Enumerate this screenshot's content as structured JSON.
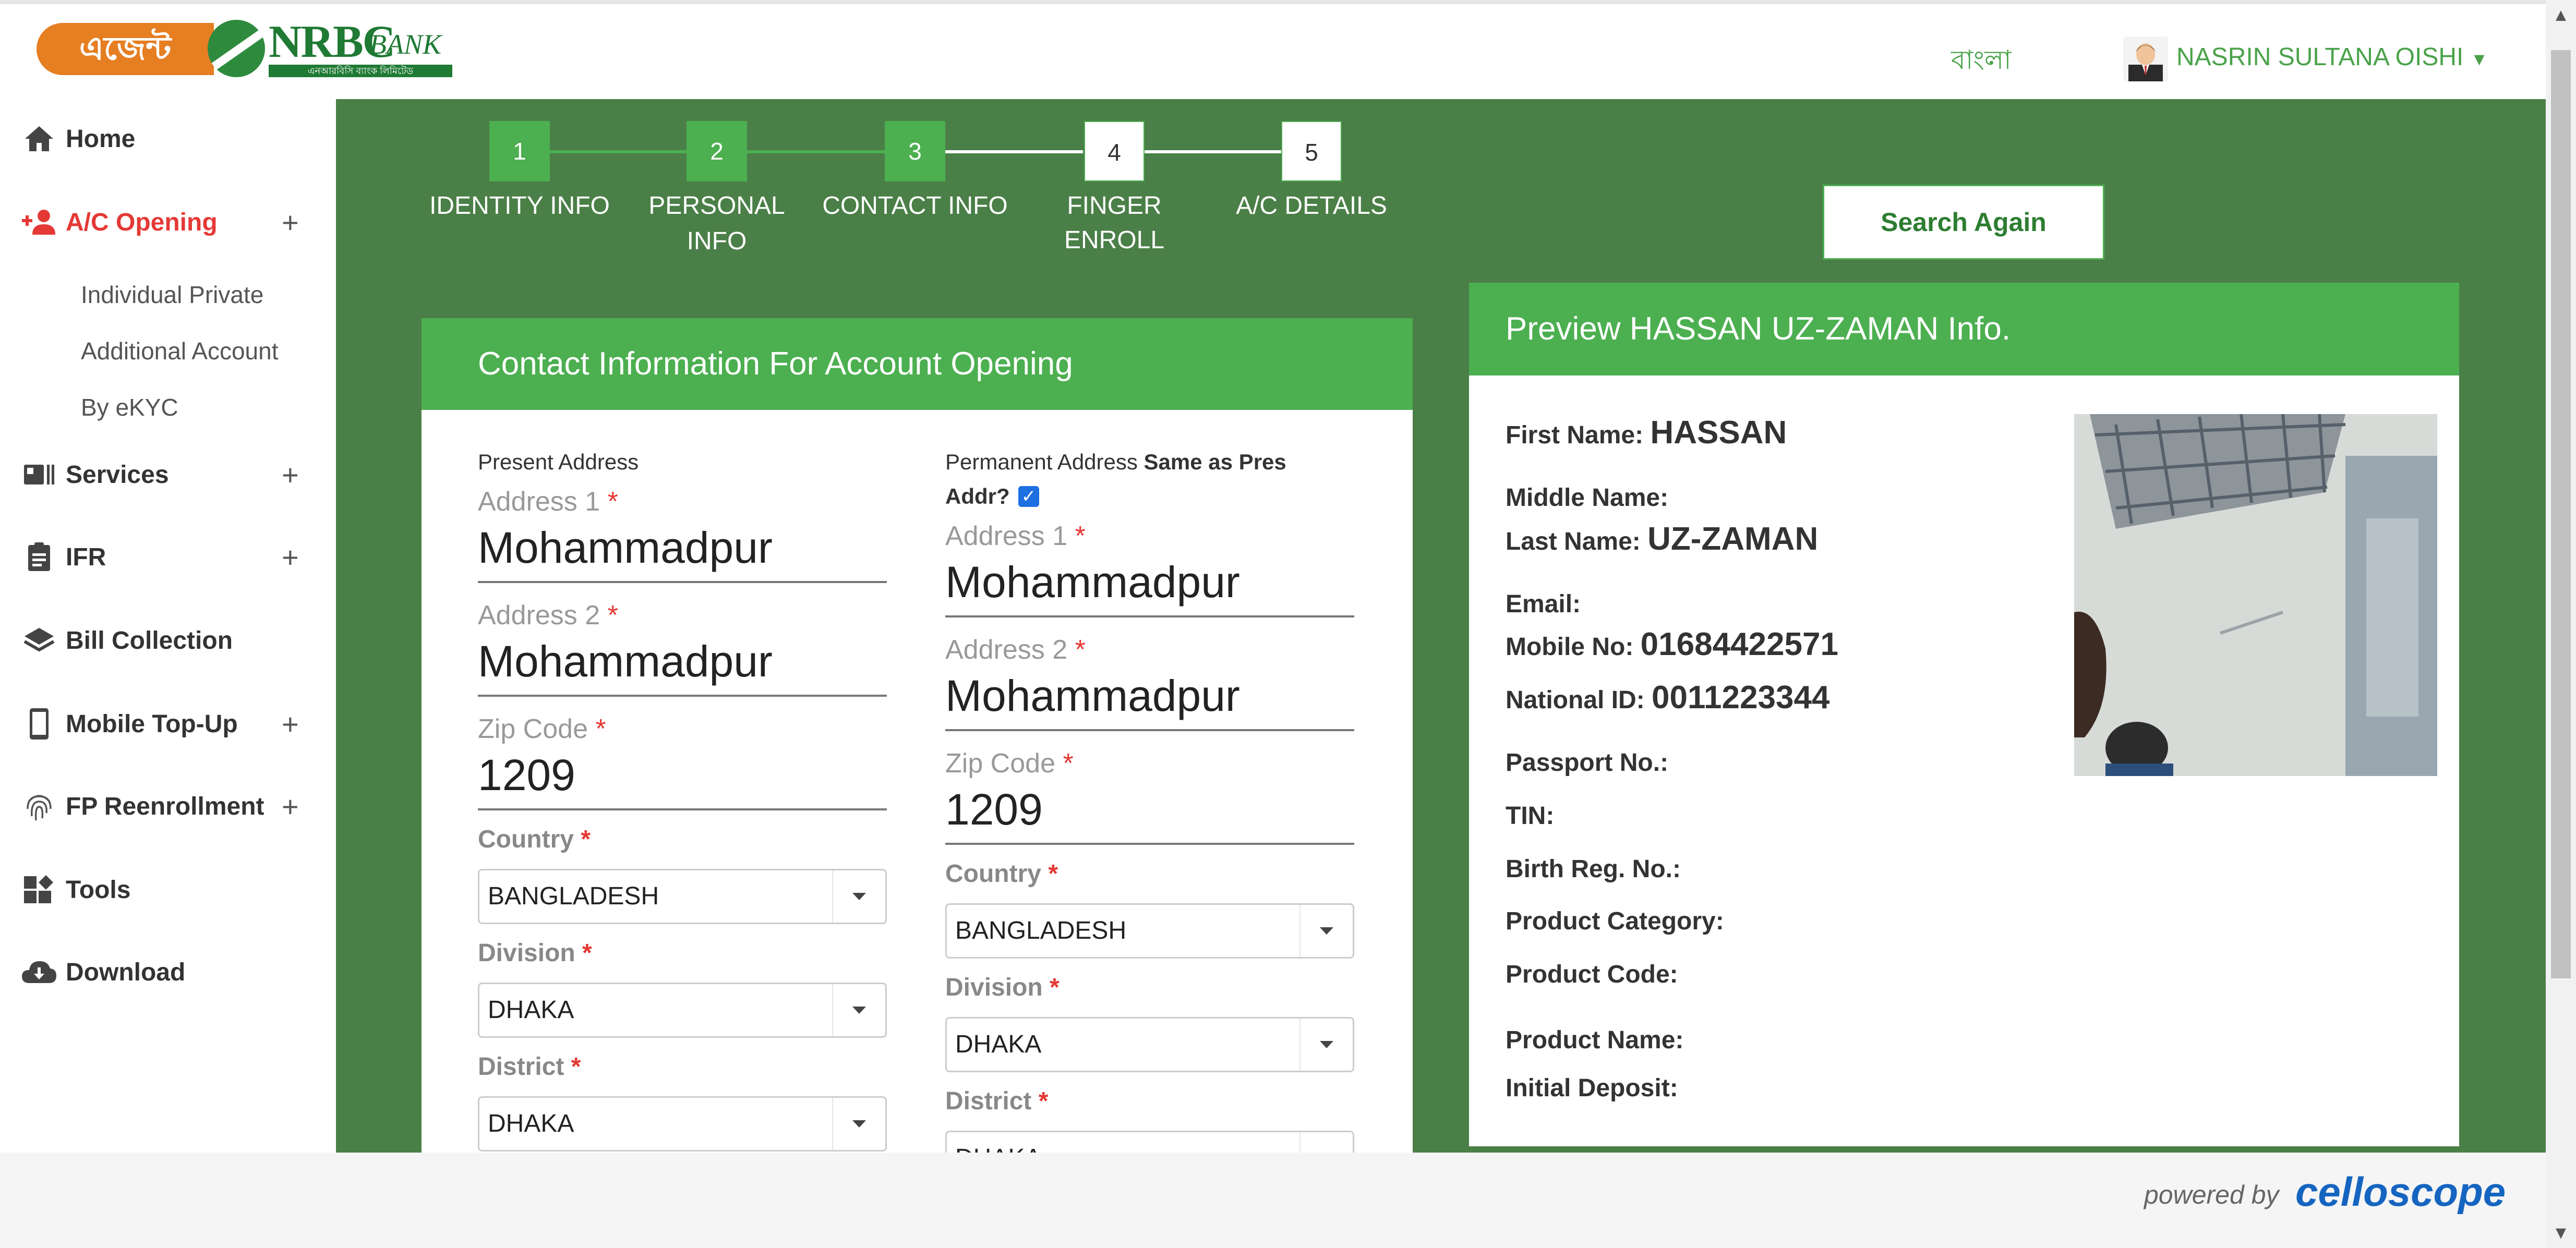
{
  "header": {
    "logo_agent_text": "এজেন্ট ব্যাংকিং",
    "logo_bank_name": "NRBC",
    "logo_bank_suffix": "BANK",
    "logo_tagline": "এনআরবিসি ব্যাংক লিমিটেড",
    "language_toggle": "বাংলা",
    "user_name": "NASRIN SULTANA OISHI"
  },
  "sidebar": {
    "items": [
      {
        "label": "Home",
        "icon": "home-icon",
        "expandable": false
      },
      {
        "label": "A/C Opening",
        "icon": "add-user-icon",
        "expandable": true,
        "active": true
      },
      {
        "label": "Services",
        "icon": "services-icon",
        "expandable": true
      },
      {
        "label": "IFR",
        "icon": "clipboard-icon",
        "expandable": true
      },
      {
        "label": "Bill Collection",
        "icon": "layers-icon",
        "expandable": false
      },
      {
        "label": "Mobile Top-Up",
        "icon": "mobile-icon",
        "expandable": true
      },
      {
        "label": "FP Reenrollment",
        "icon": "fingerprint-icon",
        "expandable": true
      },
      {
        "label": "Tools",
        "icon": "tools-icon",
        "expandable": false
      },
      {
        "label": "Download",
        "icon": "cloud-download-icon",
        "expandable": false
      }
    ],
    "subitems": [
      "Individual Private",
      "Additional Account",
      "By eKYC"
    ],
    "expand_symbol": "+"
  },
  "stepper": {
    "steps": [
      {
        "number": "1",
        "label": "IDENTITY INFO",
        "label_line2": "",
        "done": true
      },
      {
        "number": "2",
        "label": "PERSONAL",
        "label_line2": "INFO",
        "done": true
      },
      {
        "number": "3",
        "label": "CONTACT INFO",
        "label_line2": "",
        "done": true
      },
      {
        "number": "4",
        "label": "FINGER ENROLL",
        "label_line2": "",
        "done": false
      },
      {
        "number": "5",
        "label": "A/C DETAILS",
        "label_line2": "",
        "done": false
      }
    ]
  },
  "search_again_label": "Search Again",
  "form": {
    "title": "Contact Information For Account Opening",
    "present": {
      "heading": "Present Address",
      "address1_label": "Address 1",
      "address1_value": "Mohammadpur",
      "address2_label": "Address 2",
      "address2_value": "Mohammadpur",
      "zip_label": "Zip Code",
      "zip_value": "1209",
      "country_label": "Country",
      "country_value": "BANGLADESH",
      "division_label": "Division",
      "division_value": "DHAKA",
      "district_label": "District",
      "district_value": "DHAKA"
    },
    "permanent": {
      "heading": "Permanent Address",
      "same_as_label": "Same as Pres",
      "same_as_label2": "Addr?",
      "same_as_checked": true,
      "address1_label": "Address 1",
      "address1_value": "Mohammadpur",
      "address2_label": "Address 2",
      "address2_value": "Mohammadpur",
      "zip_label": "Zip Code",
      "zip_value": "1209",
      "country_label": "Country",
      "country_value": "BANGLADESH",
      "division_label": "Division",
      "division_value": "DHAKA",
      "district_label": "District",
      "district_value": "DHAKA"
    },
    "required_mark": "*"
  },
  "preview": {
    "title": "Preview HASSAN UZ-ZAMAN Info.",
    "fields": [
      {
        "label": "First Name:",
        "value": "HASSAN"
      },
      {
        "label": "Middle Name:",
        "value": ""
      },
      {
        "label": "Last Name:",
        "value": "UZ-ZAMAN"
      },
      {
        "label": "Email:",
        "value": ""
      },
      {
        "label": "Mobile No:",
        "value": "01684422571"
      },
      {
        "label": "National ID:",
        "value": "0011223344"
      },
      {
        "label": "Passport No.:",
        "value": ""
      },
      {
        "label": "TIN:",
        "value": ""
      },
      {
        "label": "Birth Reg. No.:",
        "value": ""
      },
      {
        "label": "Product Category:",
        "value": ""
      },
      {
        "label": "Product Code:",
        "value": ""
      },
      {
        "label": "Product Name:",
        "value": ""
      },
      {
        "label": "Initial Deposit:",
        "value": ""
      }
    ]
  },
  "footer": {
    "powered_by": "powered by",
    "brand": "celloscope"
  },
  "colors": {
    "main_bg": "#4a7f47",
    "card_header": "#4caf50",
    "accent_red": "#e53935",
    "brand_blue": "#1565c0",
    "logo_orange": "#e67e22"
  }
}
